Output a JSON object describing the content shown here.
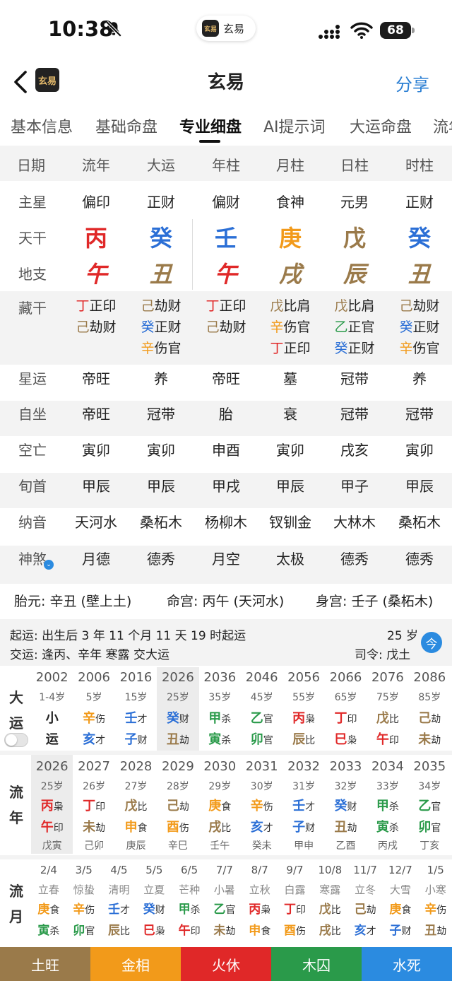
{
  "status": {
    "time": "10:38",
    "battery": "68"
  },
  "app_pill": {
    "logo": "玄易",
    "name": "玄易"
  },
  "nav": {
    "logo": "玄易",
    "title": "玄易",
    "share": "分享"
  },
  "tabs": [
    "基本信息",
    "基础命盘",
    "专业细盘",
    "AI提示词",
    "大运命盘",
    "流年"
  ],
  "grid": {
    "header": [
      "日期",
      "流年",
      "大运",
      "年柱",
      "月柱",
      "日柱",
      "时柱"
    ],
    "zhuxing": {
      "label": "主星",
      "values": [
        "偏印",
        "正财",
        "偏财",
        "食神",
        "元男",
        "正财"
      ]
    },
    "tiangan": {
      "label": "天干",
      "values": [
        "丙",
        "癸",
        "壬",
        "庚",
        "戊",
        "癸"
      ],
      "colors": [
        "#e02828",
        "#2b6fd6",
        "#2b6fd6",
        "#f29a1a",
        "#9a7a4a",
        "#2b6fd6"
      ]
    },
    "dizhi": {
      "label": "地支",
      "values": [
        "午",
        "丑",
        "午",
        "戌",
        "辰",
        "丑"
      ],
      "colors": [
        "#e02828",
        "#9a7a4a",
        "#e02828",
        "#9a7a4a",
        "#9a7a4a",
        "#9a7a4a"
      ]
    },
    "canggan": {
      "label": "藏干",
      "cols": [
        [
          {
            "g": "丁",
            "t": "正印",
            "c": "#e02828"
          },
          {
            "g": "己",
            "t": "劫财",
            "c": "#9a7a4a"
          }
        ],
        [
          {
            "g": "己",
            "t": "劫财",
            "c": "#9a7a4a"
          },
          {
            "g": "癸",
            "t": "正财",
            "c": "#2b6fd6"
          },
          {
            "g": "辛",
            "t": "伤官",
            "c": "#f29a1a"
          }
        ],
        [
          {
            "g": "丁",
            "t": "正印",
            "c": "#e02828"
          },
          {
            "g": "己",
            "t": "劫财",
            "c": "#9a7a4a"
          }
        ],
        [
          {
            "g": "戊",
            "t": "比肩",
            "c": "#9a7a4a"
          },
          {
            "g": "辛",
            "t": "伤官",
            "c": "#f29a1a"
          },
          {
            "g": "丁",
            "t": "正印",
            "c": "#e02828"
          }
        ],
        [
          {
            "g": "戊",
            "t": "比肩",
            "c": "#9a7a4a"
          },
          {
            "g": "乙",
            "t": "正官",
            "c": "#2a9a4a"
          },
          {
            "g": "癸",
            "t": "正财",
            "c": "#2b6fd6"
          }
        ],
        [
          {
            "g": "己",
            "t": "劫财",
            "c": "#9a7a4a"
          },
          {
            "g": "癸",
            "t": "正财",
            "c": "#2b6fd6"
          },
          {
            "g": "辛",
            "t": "伤官",
            "c": "#f29a1a"
          }
        ]
      ]
    },
    "xingyun": {
      "label": "星运",
      "values": [
        "帝旺",
        "养",
        "帝旺",
        "墓",
        "冠带",
        "养"
      ]
    },
    "zizuo": {
      "label": "自坐",
      "values": [
        "帝旺",
        "冠带",
        "胎",
        "衰",
        "冠带",
        "冠带"
      ]
    },
    "kongwang": {
      "label": "空亡",
      "values": [
        "寅卯",
        "寅卯",
        "申酉",
        "寅卯",
        "戌亥",
        "寅卯"
      ]
    },
    "xunshou": {
      "label": "旬首",
      "values": [
        "甲辰",
        "甲辰",
        "甲戌",
        "甲辰",
        "甲子",
        "甲辰"
      ]
    },
    "nayin": {
      "label": "纳音",
      "values": [
        "天河水",
        "桑柘木",
        "杨柳木",
        "钗钏金",
        "大林木",
        "桑柘木"
      ]
    },
    "shensha": {
      "label": "神煞",
      "values": [
        "月德",
        "德秀",
        "月空",
        "太极",
        "德秀",
        "德秀"
      ]
    }
  },
  "palace": {
    "taiyuan": "胎元: 辛丑 (壁上土)",
    "minggong": "命宫: 丙午 (天河水)",
    "shengong": "身宫: 壬子 (桑柘木)"
  },
  "qiyun": {
    "line1": "起运: 出生后 3 年 11 个月 11 天 19 时起运",
    "line2": "交运: 逢丙、辛年 寒露 交大运",
    "age": "25 岁",
    "siling": "司令: 戊土",
    "today": "今"
  },
  "dayun": {
    "label1": "大",
    "label2": "运",
    "cols": [
      {
        "year": "2002",
        "age": "1-4岁",
        "g": "小",
        "gt": "",
        "gc": "#222",
        "z": "运",
        "zt": "",
        "zc": "#222"
      },
      {
        "year": "2006",
        "age": "5岁",
        "g": "辛",
        "gt": "伤",
        "gc": "#f29a1a",
        "z": "亥",
        "zt": "才",
        "zc": "#2b6fd6"
      },
      {
        "year": "2016",
        "age": "15岁",
        "g": "壬",
        "gt": "才",
        "gc": "#2b6fd6",
        "z": "子",
        "zt": "财",
        "zc": "#2b6fd6"
      },
      {
        "year": "2026",
        "age": "25岁",
        "g": "癸",
        "gt": "财",
        "gc": "#2b6fd6",
        "z": "丑",
        "zt": "劫",
        "zc": "#9a7a4a"
      },
      {
        "year": "2036",
        "age": "35岁",
        "g": "甲",
        "gt": "杀",
        "gc": "#2a9a4a",
        "z": "寅",
        "zt": "杀",
        "zc": "#2a9a4a"
      },
      {
        "year": "2046",
        "age": "45岁",
        "g": "乙",
        "gt": "官",
        "gc": "#2a9a4a",
        "z": "卯",
        "zt": "官",
        "zc": "#2a9a4a"
      },
      {
        "year": "2056",
        "age": "55岁",
        "g": "丙",
        "gt": "枭",
        "gc": "#e02828",
        "z": "辰",
        "zt": "比",
        "zc": "#9a7a4a"
      },
      {
        "year": "2066",
        "age": "65岁",
        "g": "丁",
        "gt": "印",
        "gc": "#e02828",
        "z": "巳",
        "zt": "枭",
        "zc": "#e02828"
      },
      {
        "year": "2076",
        "age": "75岁",
        "g": "戊",
        "gt": "比",
        "gc": "#9a7a4a",
        "z": "午",
        "zt": "印",
        "zc": "#e02828"
      },
      {
        "year": "2086",
        "age": "85岁",
        "g": "己",
        "gt": "劫",
        "gc": "#9a7a4a",
        "z": "未",
        "zt": "劫",
        "zc": "#9a7a4a"
      }
    ]
  },
  "liunian": {
    "label1": "流",
    "label2": "年",
    "cols": [
      {
        "year": "2026",
        "age": "25岁",
        "g": "丙",
        "gt": "枭",
        "gc": "#e02828",
        "z": "午",
        "zt": "印",
        "zc": "#e02828",
        "gz": "戊寅"
      },
      {
        "year": "2027",
        "age": "26岁",
        "g": "丁",
        "gt": "印",
        "gc": "#e02828",
        "z": "未",
        "zt": "劫",
        "zc": "#9a7a4a",
        "gz": "己卯"
      },
      {
        "year": "2028",
        "age": "27岁",
        "g": "戊",
        "gt": "比",
        "gc": "#9a7a4a",
        "z": "申",
        "zt": "食",
        "zc": "#f29a1a",
        "gz": "庚辰"
      },
      {
        "year": "2029",
        "age": "28岁",
        "g": "己",
        "gt": "劫",
        "gc": "#9a7a4a",
        "z": "酉",
        "zt": "伤",
        "zc": "#f29a1a",
        "gz": "辛巳"
      },
      {
        "year": "2030",
        "age": "29岁",
        "g": "庚",
        "gt": "食",
        "gc": "#f29a1a",
        "z": "戌",
        "zt": "比",
        "zc": "#9a7a4a",
        "gz": "壬午"
      },
      {
        "year": "2031",
        "age": "30岁",
        "g": "辛",
        "gt": "伤",
        "gc": "#f29a1a",
        "z": "亥",
        "zt": "才",
        "zc": "#2b6fd6",
        "gz": "癸未"
      },
      {
        "year": "2032",
        "age": "31岁",
        "g": "壬",
        "gt": "才",
        "gc": "#2b6fd6",
        "z": "子",
        "zt": "财",
        "zc": "#2b6fd6",
        "gz": "甲申"
      },
      {
        "year": "2033",
        "age": "32岁",
        "g": "癸",
        "gt": "财",
        "gc": "#2b6fd6",
        "z": "丑",
        "zt": "劫",
        "zc": "#9a7a4a",
        "gz": "乙酉"
      },
      {
        "year": "2034",
        "age": "33岁",
        "g": "甲",
        "gt": "杀",
        "gc": "#2a9a4a",
        "z": "寅",
        "zt": "杀",
        "zc": "#2a9a4a",
        "gz": "丙戌"
      },
      {
        "year": "2035",
        "age": "34岁",
        "g": "乙",
        "gt": "官",
        "gc": "#2a9a4a",
        "z": "卯",
        "zt": "官",
        "zc": "#2a9a4a",
        "gz": "丁亥"
      }
    ]
  },
  "liuyue": {
    "label1": "流",
    "label2": "月",
    "cols": [
      {
        "date": "2/4",
        "jie": "立春",
        "g": "庚",
        "gt": "食",
        "gc": "#f29a1a",
        "z": "寅",
        "zt": "杀",
        "zc": "#2a9a4a"
      },
      {
        "date": "3/5",
        "jie": "惊蛰",
        "g": "辛",
        "gt": "伤",
        "gc": "#f29a1a",
        "z": "卯",
        "zt": "官",
        "zc": "#2a9a4a"
      },
      {
        "date": "4/5",
        "jie": "清明",
        "g": "壬",
        "gt": "才",
        "gc": "#2b6fd6",
        "z": "辰",
        "zt": "比",
        "zc": "#9a7a4a"
      },
      {
        "date": "5/5",
        "jie": "立夏",
        "g": "癸",
        "gt": "财",
        "gc": "#2b6fd6",
        "z": "巳",
        "zt": "枭",
        "zc": "#e02828"
      },
      {
        "date": "6/5",
        "jie": "芒种",
        "g": "甲",
        "gt": "杀",
        "gc": "#2a9a4a",
        "z": "午",
        "zt": "印",
        "zc": "#e02828"
      },
      {
        "date": "7/7",
        "jie": "小暑",
        "g": "乙",
        "gt": "官",
        "gc": "#2a9a4a",
        "z": "未",
        "zt": "劫",
        "zc": "#9a7a4a"
      },
      {
        "date": "8/7",
        "jie": "立秋",
        "g": "丙",
        "gt": "枭",
        "gc": "#e02828",
        "z": "申",
        "zt": "食",
        "zc": "#f29a1a"
      },
      {
        "date": "9/7",
        "jie": "白露",
        "g": "丁",
        "gt": "印",
        "gc": "#e02828",
        "z": "酉",
        "zt": "伤",
        "zc": "#f29a1a"
      },
      {
        "date": "10/8",
        "jie": "寒露",
        "g": "戊",
        "gt": "比",
        "gc": "#9a7a4a",
        "z": "戌",
        "zt": "比",
        "zc": "#9a7a4a"
      },
      {
        "date": "11/7",
        "jie": "立冬",
        "g": "己",
        "gt": "劫",
        "gc": "#9a7a4a",
        "z": "亥",
        "zt": "才",
        "zc": "#2b6fd6"
      },
      {
        "date": "12/7",
        "jie": "大雪",
        "g": "庚",
        "gt": "食",
        "gc": "#f29a1a",
        "z": "子",
        "zt": "财",
        "zc": "#2b6fd6"
      },
      {
        "date": "1/5",
        "jie": "小寒",
        "g": "辛",
        "gt": "伤",
        "gc": "#f29a1a",
        "z": "丑",
        "zt": "劫",
        "zc": "#9a7a4a"
      }
    ]
  },
  "elements": [
    {
      "label": "土旺",
      "color": "#9a7a4a"
    },
    {
      "label": "金相",
      "color": "#f29a1a"
    },
    {
      "label": "火休",
      "color": "#e02828"
    },
    {
      "label": "木囚",
      "color": "#2a9a4a"
    },
    {
      "label": "水死",
      "color": "#2b8be0"
    }
  ]
}
